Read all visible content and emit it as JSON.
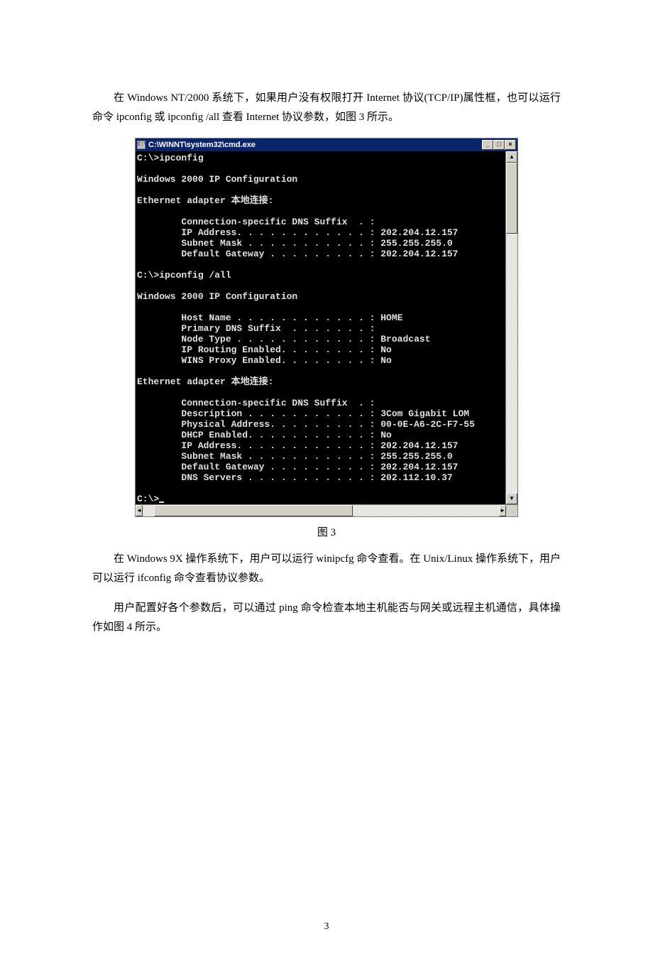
{
  "para1": "在 Windows NT/2000 系统下，如果用户没有权限打开 Internet 协议(TCP/IP)属性框，也可以运行命令 ipconfig 或 ipconfig /all 查看 Internet 协议参数，如图 3 所示。",
  "terminal": {
    "title": "C:\\WINNT\\system32\\cmd.exe",
    "lines": [
      "C:\\>ipconfig",
      "",
      "Windows 2000 IP Configuration",
      "",
      "Ethernet adapter 本地连接:",
      "",
      "        Connection-specific DNS Suffix  . :",
      "        IP Address. . . . . . . . . . . . : 202.204.12.157",
      "        Subnet Mask . . . . . . . . . . . : 255.255.255.0",
      "        Default Gateway . . . . . . . . . : 202.204.12.157",
      "",
      "C:\\>ipconfig /all",
      "",
      "Windows 2000 IP Configuration",
      "",
      "        Host Name . . . . . . . . . . . . : HOME",
      "        Primary DNS Suffix  . . . . . . . :",
      "        Node Type . . . . . . . . . . . . : Broadcast",
      "        IP Routing Enabled. . . . . . . . : No",
      "        WINS Proxy Enabled. . . . . . . . : No",
      "",
      "Ethernet adapter 本地连接:",
      "",
      "        Connection-specific DNS Suffix  . :",
      "        Description . . . . . . . . . . . : 3Com Gigabit LOM",
      "        Physical Address. . . . . . . . . : 00-0E-A6-2C-F7-55",
      "        DHCP Enabled. . . . . . . . . . . : No",
      "        IP Address. . . . . . . . . . . . : 202.204.12.157",
      "        Subnet Mask . . . . . . . . . . . : 255.255.255.0",
      "        Default Gateway . . . . . . . . . : 202.204.12.157",
      "        DNS Servers . . . . . . . . . . . : 202.112.10.37",
      "",
      "C:\\>"
    ]
  },
  "caption": "图 3",
  "para2": "在 Windows 9X 操作系统下，用户可以运行 winipcfg 命令查看。在 Unix/Linux 操作系统下，用户可以运行 ifconfig 命令查看协议参数。",
  "para3": "用户配置好各个参数后，可以通过 ping 命令检查本地主机能否与网关或远程主机通信，具体操作如图 4 所示。",
  "page_number": "3",
  "btn": {
    "min": "_",
    "max": "□",
    "close": "×",
    "up": "▲",
    "down": "▼",
    "left": "◄",
    "right": "►"
  }
}
